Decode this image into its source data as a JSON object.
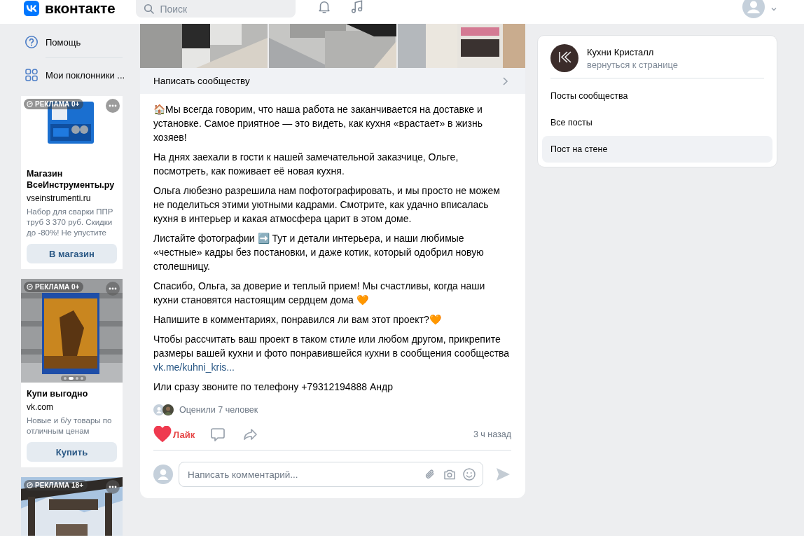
{
  "header": {
    "logo_text": "вконтакте",
    "search": {
      "placeholder": "Поиск"
    }
  },
  "sidebar": {
    "items": [
      {
        "label": "Помощь"
      },
      {
        "label": "Мои поклонники ..."
      }
    ]
  },
  "ads": [
    {
      "badge": "РЕКЛАМА 0+",
      "title": "Магазин ВсеИнструменты.ру",
      "domain": "vseinstrumenti.ru",
      "description": "Набор для сварки ППР труб 3 370 руб. Скидки до -80%! Не упустите",
      "button": "В магазин"
    },
    {
      "badge": "РЕКЛАМА 0+",
      "dots": [
        {
          "selected": false
        },
        {
          "selected": true
        },
        {
          "selected": false
        },
        {
          "selected": false
        }
      ],
      "title": "Купи выгодно",
      "domain": "vk.com",
      "description": "Новые и б/у товары по отличным ценам",
      "button": "Купить"
    },
    {
      "badge": "РЕКЛАМА 18+"
    }
  ],
  "post": {
    "message_button": "Написать сообществу",
    "paragraphs": [
      {
        "text": "🏠Мы всегда говорим, что наша работа не заканчивается на доставке и установке. Самое приятное — это видеть, как кухня «врастает» в жизнь хозяев!"
      },
      {
        "text": "На днях заехали в гости к нашей замечательной заказчице, Ольге, посмотреть, как поживает её новая кухня."
      },
      {
        "text": "Ольга любезно разрешила нам пофотографировать, и мы просто не можем не поделиться этими уютными кадрами. Смотрите, как удачно вписалась кухня в интерьер и какая атмосфера царит в этом доме."
      },
      {
        "text": "Листайте фотографии ➡️ Тут и детали интерьера, и наши любимые «честные» кадры без постановки, и даже котик, который одобрил новую столешницу."
      },
      {
        "text": "Спасибо, Ольга, за доверие и теплый прием! Мы счастливы, когда наши кухни становятся настоящим сердцем дома 🧡"
      },
      {
        "text": "Напишите в комментариях, понравился ли вам этот проект?🧡"
      },
      {
        "text": "Чтобы рассчитать ваш проект в таком стиле или любом другом, прикрепите размеры вашей кухни и фото понравившейся кухни в сообщения сообщества ",
        "link": "vk.me/kuhni_kris..."
      },
      {
        "text": "Или сразу звоните по телефону +79312194888 Андр"
      }
    ],
    "likers_text": "Оценили 7 человек",
    "like": {
      "label": "Лайк",
      "liked": true
    },
    "time": "3 ч назад",
    "comment": {
      "placeholder": "Написать комментарий..."
    }
  },
  "community": {
    "name": "Кухни Кристалл",
    "subtitle": "вернуться к странице",
    "menu": [
      {
        "label": "Посты сообщества",
        "selected": false
      },
      {
        "label": "Все посты",
        "selected": false
      },
      {
        "label": "Пост на стене",
        "selected": true
      }
    ]
  }
}
